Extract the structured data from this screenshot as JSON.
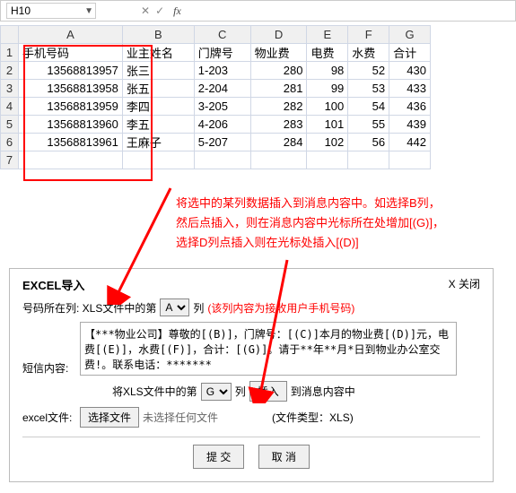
{
  "formula_bar": {
    "cell_name": "H10",
    "cancel": "✕",
    "confirm": "✓",
    "fx": "fx"
  },
  "columns": [
    "A",
    "B",
    "C",
    "D",
    "E",
    "F",
    "G"
  ],
  "headers": [
    "手机号码",
    "业主姓名",
    "门牌号",
    "物业费",
    "电费",
    "水费",
    "合计"
  ],
  "rows": [
    [
      "13568813957",
      "张三",
      "1-203",
      "280",
      "98",
      "52",
      "430"
    ],
    [
      "13568813958",
      "张五",
      "2-204",
      "281",
      "99",
      "53",
      "433"
    ],
    [
      "13568813959",
      "李四",
      "3-205",
      "282",
      "100",
      "54",
      "436"
    ],
    [
      "13568813960",
      "李五",
      "4-206",
      "283",
      "101",
      "55",
      "439"
    ],
    [
      "13568813961",
      "王麻子",
      "5-207",
      "284",
      "102",
      "56",
      "442"
    ]
  ],
  "note_lines": [
    "将选中的某列数据插入到消息内容中。如选择B列，",
    "然后点插入，则在消息内容中光标所在处增加[(G)]，",
    "选择D列点插入则在光标处插入[(D)]"
  ],
  "dialog": {
    "title": "EXCEL导入",
    "close": "X 关闭",
    "phone_label_pre": "号码所在列: XLS文件中的第",
    "phone_select": "A",
    "phone_label_post": "列",
    "phone_hint": "(该列内容为接收用户手机号码)",
    "sms_label": "短信内容:",
    "sms_content": "【***物业公司】尊敬的[(B)]，门牌号：[(C)]本月的物业费[(D)]元，电费[(E)]，水费[(F)]，合计：[(G)]。请于**年**月*日到物业办公室交费!。联系电话：*******",
    "insert_pre": "将XLS文件中的第",
    "insert_select": "G",
    "insert_post": "列",
    "insert_btn": "插入",
    "insert_tail": "到消息内容中",
    "file_label": "excel文件:",
    "file_btn": "选择文件",
    "file_none": "未选择任何文件",
    "file_type": "(文件类型：XLS)",
    "submit": "提 交",
    "cancel": "取 消"
  }
}
